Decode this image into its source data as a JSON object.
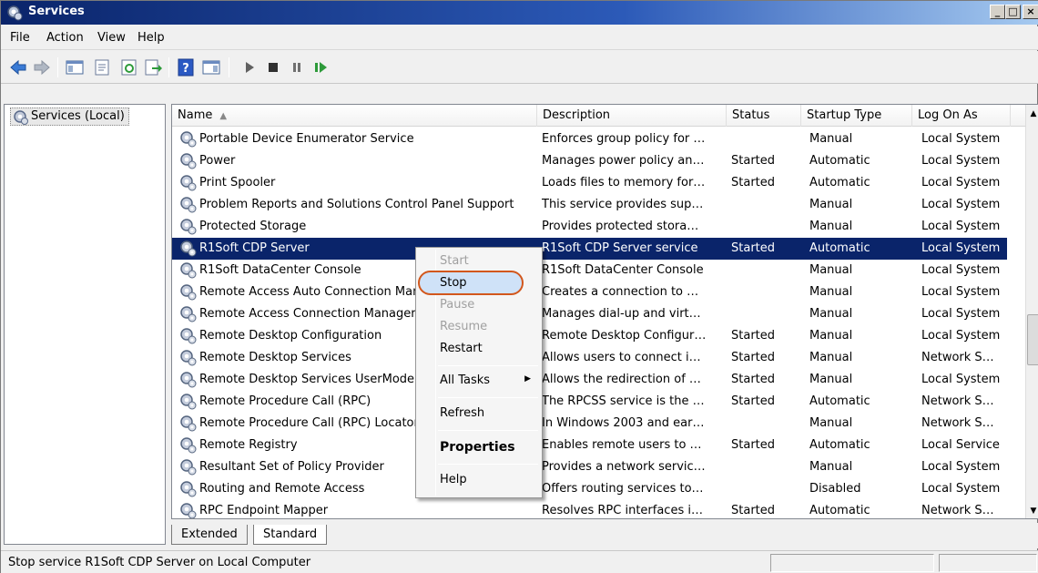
{
  "window": {
    "title": "Services",
    "controls": {
      "minimize": "_",
      "maximize": "□",
      "close": "×"
    }
  },
  "menu": [
    "File",
    "Action",
    "View",
    "Help"
  ],
  "toolbar": {
    "icons": [
      "back-arrow-icon",
      "forward-arrow-icon",
      "show-console-tree-icon",
      "properties-icon",
      "refresh-icon",
      "export-list-icon",
      "help-icon",
      "show-hide-action-pane-icon",
      "start-service-icon",
      "stop-service-icon",
      "pause-service-icon",
      "restart-service-icon"
    ]
  },
  "tree": {
    "label": "Services (Local)"
  },
  "list": {
    "columns": {
      "name": "Name",
      "description": "Description",
      "status": "Status",
      "startup": "Startup Type",
      "logon": "Log On As"
    },
    "rows": [
      {
        "name": "Portable Device Enumerator Service",
        "description": "Enforces group policy for …",
        "status": "",
        "startup": "Manual",
        "logon": "Local System"
      },
      {
        "name": "Power",
        "description": "Manages power policy an…",
        "status": "Started",
        "startup": "Automatic",
        "logon": "Local System"
      },
      {
        "name": "Print Spooler",
        "description": "Loads files to memory for…",
        "status": "Started",
        "startup": "Automatic",
        "logon": "Local System"
      },
      {
        "name": "Problem Reports and Solutions Control Panel Support",
        "description": "This service provides sup…",
        "status": "",
        "startup": "Manual",
        "logon": "Local System"
      },
      {
        "name": "Protected Storage",
        "description": "Provides protected stora…",
        "status": "",
        "startup": "Manual",
        "logon": "Local System"
      },
      {
        "name": "R1Soft CDP Server",
        "description": "R1Soft CDP Server service",
        "status": "Started",
        "startup": "Automatic",
        "logon": "Local System",
        "selected": true
      },
      {
        "name": "R1Soft DataCenter Console",
        "description": "R1Soft DataCenter Console",
        "status": "",
        "startup": "Manual",
        "logon": "Local System"
      },
      {
        "name": "Remote Access Auto Connection Manager",
        "description": "Creates a connection to …",
        "status": "",
        "startup": "Manual",
        "logon": "Local System"
      },
      {
        "name": "Remote Access Connection Manager",
        "description": "Manages dial-up and virt…",
        "status": "",
        "startup": "Manual",
        "logon": "Local System"
      },
      {
        "name": "Remote Desktop Configuration",
        "description": "Remote Desktop Configur…",
        "status": "Started",
        "startup": "Manual",
        "logon": "Local System"
      },
      {
        "name": "Remote Desktop Services",
        "description": "Allows users to connect i…",
        "status": "Started",
        "startup": "Manual",
        "logon": "Network S…"
      },
      {
        "name": "Remote Desktop Services UserMode Port Redirector",
        "description": "Allows the redirection of …",
        "status": "Started",
        "startup": "Manual",
        "logon": "Local System"
      },
      {
        "name": "Remote Procedure Call (RPC)",
        "description": "The RPCSS service is the …",
        "status": "Started",
        "startup": "Automatic",
        "logon": "Network S…"
      },
      {
        "name": "Remote Procedure Call (RPC) Locator",
        "description": "In Windows 2003 and ear…",
        "status": "",
        "startup": "Manual",
        "logon": "Network S…"
      },
      {
        "name": "Remote Registry",
        "description": "Enables remote users to …",
        "status": "Started",
        "startup": "Automatic",
        "logon": "Local Service"
      },
      {
        "name": "Resultant Set of Policy Provider",
        "description": "Provides a network servic…",
        "status": "",
        "startup": "Manual",
        "logon": "Local System"
      },
      {
        "name": "Routing and Remote Access",
        "description": "Offers routing services to…",
        "status": "",
        "startup": "Disabled",
        "logon": "Local System"
      },
      {
        "name": "RPC Endpoint Mapper",
        "description": "Resolves RPC interfaces i…",
        "status": "Started",
        "startup": "Automatic",
        "logon": "Network S…"
      }
    ]
  },
  "tabs": [
    "Extended",
    "Standard"
  ],
  "status_bar": {
    "text": "Stop service R1Soft CDP Server on Local Computer"
  },
  "context_menu": {
    "items": [
      {
        "label": "Start",
        "enabled": false
      },
      {
        "label": "Stop",
        "enabled": true,
        "highlighted": true
      },
      {
        "label": "Pause",
        "enabled": false
      },
      {
        "label": "Resume",
        "enabled": false
      },
      {
        "label": "Restart",
        "enabled": true
      },
      {
        "label": "All Tasks",
        "enabled": true,
        "submenu": true
      },
      {
        "label": "Refresh",
        "enabled": true
      },
      {
        "label": "Properties",
        "enabled": true,
        "bold": true
      },
      {
        "label": "Help",
        "enabled": true
      }
    ]
  },
  "colors": {
    "selection": "#0a246a",
    "highlight_ring": "#d2571c"
  }
}
